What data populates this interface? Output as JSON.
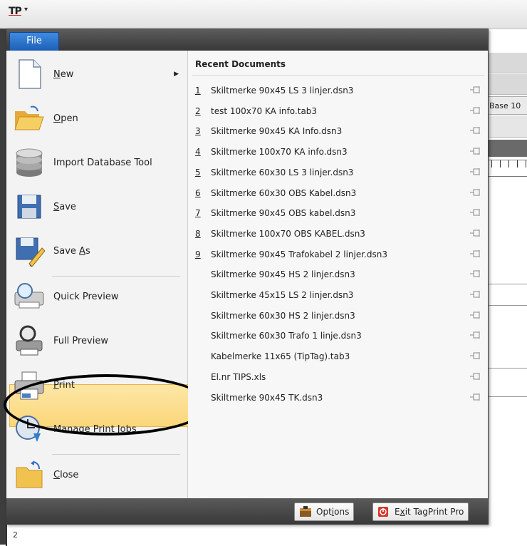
{
  "app": {
    "logo": "TP",
    "qat": "▾"
  },
  "file_tab": "File",
  "commands": [
    {
      "pre": "",
      "key": "N",
      "post": "ew",
      "has_submenu": true
    },
    {
      "pre": "",
      "key": "O",
      "post": "pen"
    },
    {
      "pre": "Import Database Tool",
      "key": "",
      "post": ""
    },
    {
      "pre": "",
      "key": "S",
      "post": "ave"
    },
    {
      "pre": "Save ",
      "key": "A",
      "post": "s"
    },
    {
      "pre": "Quick Preview",
      "key": "",
      "post": ""
    },
    {
      "pre": "Full Preview",
      "key": "",
      "post": ""
    },
    {
      "pre": "",
      "key": "P",
      "post": "rint"
    },
    {
      "pre": "Manage Print Jobs",
      "key": "",
      "post": ""
    },
    {
      "pre": "",
      "key": "C",
      "post": "lose"
    }
  ],
  "recent": {
    "title": "Recent Documents",
    "items": [
      {
        "num": "1",
        "name": "Skiltmerke 90x45 LS 3 linjer.dsn3"
      },
      {
        "num": "2",
        "name": "test 100x70 KA info.tab3"
      },
      {
        "num": "3",
        "name": "Skiltmerke 90x45 KA Info.dsn3"
      },
      {
        "num": "4",
        "name": "Skiltmerke 100x70 KA info.dsn3"
      },
      {
        "num": "5",
        "name": "Skiltmerke 60x30 LS 3 linjer.dsn3"
      },
      {
        "num": "6",
        "name": "Skiltmerke 60x30 OBS Kabel.dsn3"
      },
      {
        "num": "7",
        "name": "Skiltmerke 90x45 OBS kabel.dsn3"
      },
      {
        "num": "8",
        "name": "Skiltmerke 100x70 OBS KABEL.dsn3"
      },
      {
        "num": "9",
        "name": "Skiltmerke 90x45 Trafokabel 2 linjer.dsn3"
      },
      {
        "num": "",
        "name": "Skiltmerke 90x45 HS 2 linjer.dsn3"
      },
      {
        "num": "",
        "name": "Skiltmerke 45x15 LS 2 linjer.dsn3"
      },
      {
        "num": "",
        "name": "Skiltmerke 60x30 HS 2 linjer.dsn3"
      },
      {
        "num": "",
        "name": "Skiltmerke 60x30 Trafo 1 linje.dsn3"
      },
      {
        "num": "",
        "name": "Kabelmerke 11x65 (TipTag).tab3"
      },
      {
        "num": "",
        "name": "El.nr TIPS.xls"
      },
      {
        "num": "",
        "name": "Skiltmerke 90x45 TK.dsn3"
      }
    ]
  },
  "footer": {
    "options": {
      "pre": "Opt",
      "key": "i",
      "post": "ons"
    },
    "exit": {
      "pre": "E",
      "key": "x",
      "post": "it TagPrint Pro"
    }
  },
  "background": {
    "base_label": "Base 10",
    "page_num": "2"
  },
  "colors": {
    "highlight": "#fbd67a",
    "file_tab": "#1e5fb8",
    "header": "#3a3a3a"
  }
}
